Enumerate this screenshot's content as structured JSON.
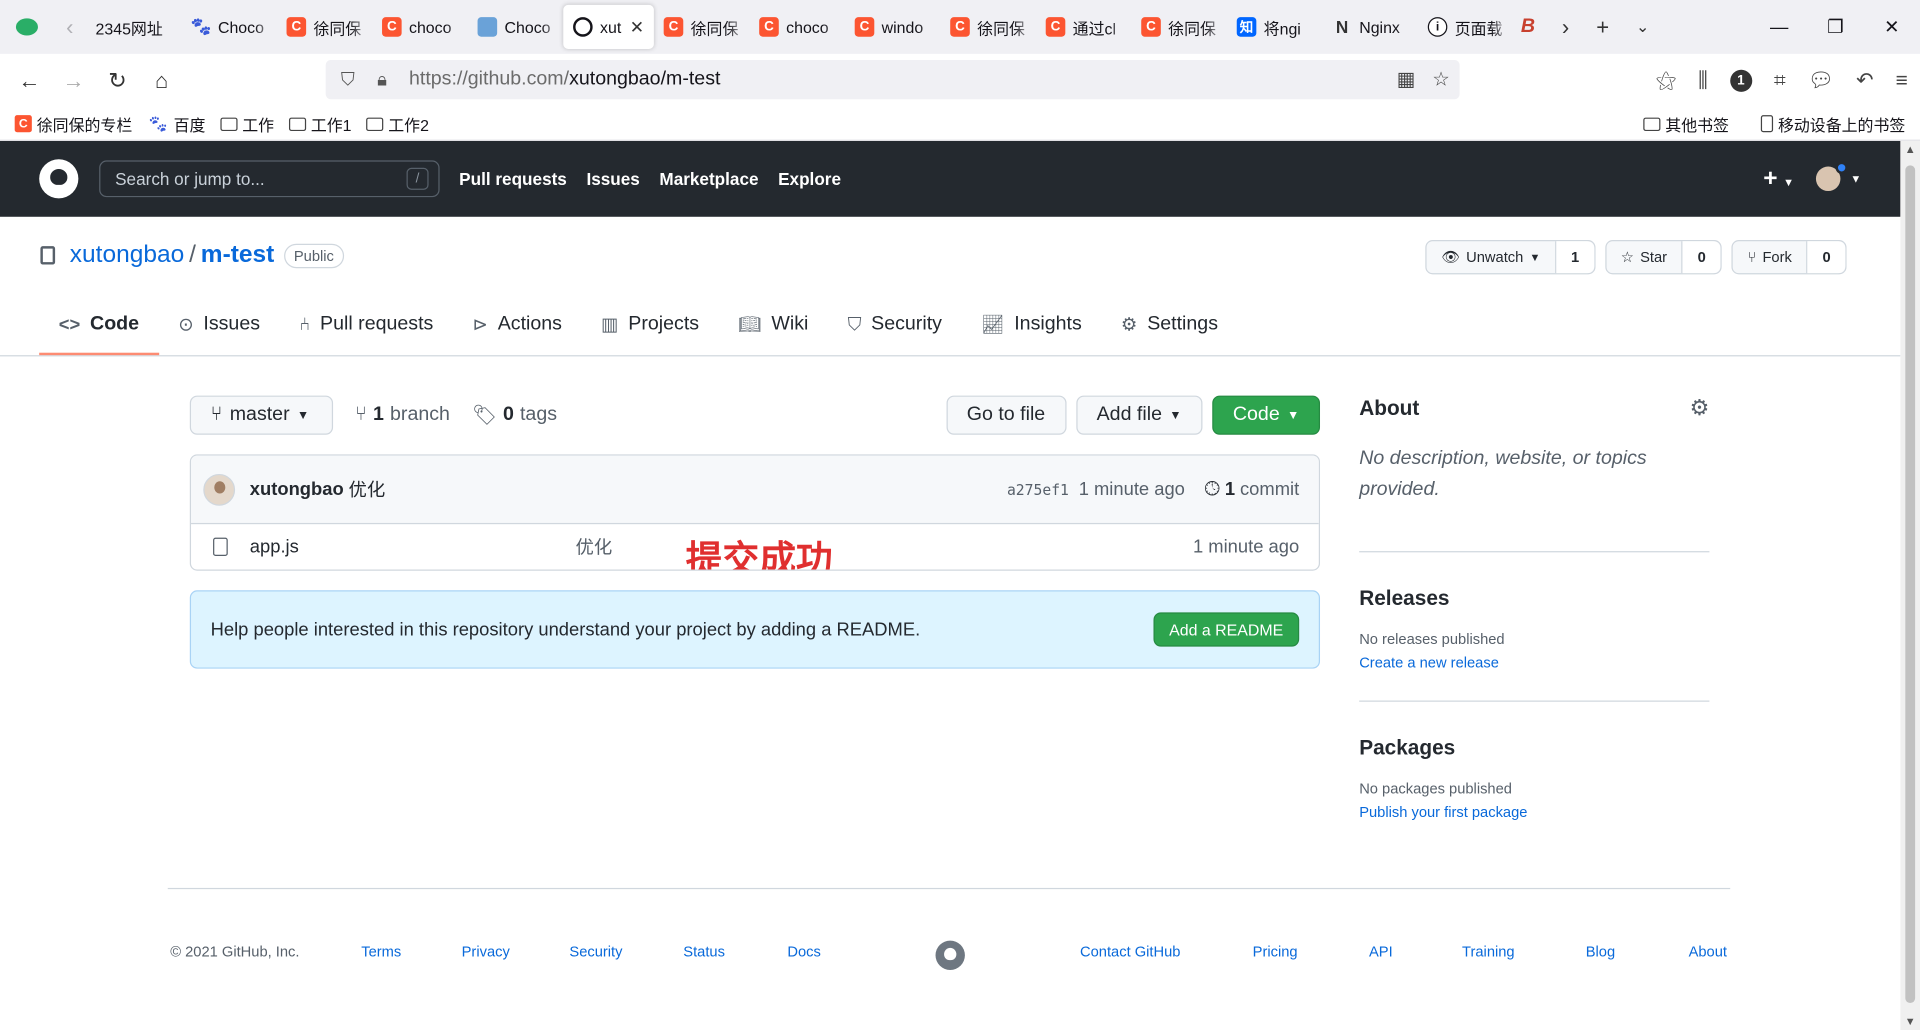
{
  "browser": {
    "tabs": [
      {
        "title": "2345网址",
        "favicon": "2345-icon",
        "active": false
      },
      {
        "title": "Choco",
        "favicon": "paw-icon",
        "active": false
      },
      {
        "title": "徐同保",
        "favicon": "csdn-icon",
        "active": false
      },
      {
        "title": "choco",
        "favicon": "csdn-icon",
        "active": false
      },
      {
        "title": "Choco",
        "favicon": "image-icon",
        "active": false
      },
      {
        "title": "xut",
        "favicon": "github-icon",
        "active": true
      },
      {
        "title": "徐同保",
        "favicon": "csdn-icon",
        "active": false
      },
      {
        "title": "choco",
        "favicon": "csdn-icon",
        "active": false
      },
      {
        "title": "windo",
        "favicon": "csdn-icon",
        "active": false
      },
      {
        "title": "徐同保",
        "favicon": "csdn-icon",
        "active": false
      },
      {
        "title": "通过cl",
        "favicon": "csdn-icon",
        "active": false
      },
      {
        "title": "徐同保",
        "favicon": "csdn-icon",
        "active": false
      },
      {
        "title": "将ngi",
        "favicon": "zhihu-icon",
        "active": false
      },
      {
        "title": "Nginx",
        "favicon": "nginx-icon",
        "active": false
      },
      {
        "title": "页面载",
        "favicon": "info-icon",
        "active": false
      }
    ],
    "url_host": "https://github.com/",
    "url_path": "xutongbao/m-test",
    "bookmarks_left": [
      "徐同保的专栏",
      "百度",
      "工作",
      "工作1",
      "工作2"
    ],
    "bookmarks_right": [
      "其他书签",
      "移动设备上的书签"
    ]
  },
  "github": {
    "search_placeholder": "Search or jump to...",
    "search_key": "/",
    "nav": [
      "Pull requests",
      "Issues",
      "Marketplace",
      "Explore"
    ]
  },
  "repo": {
    "owner": "xutongbao",
    "separator": "/",
    "name": "m-test",
    "visibility": "Public",
    "watch_label": "Unwatch",
    "watch_count": "1",
    "star_label": "Star",
    "star_count": "0",
    "fork_label": "Fork",
    "fork_count": "0",
    "tabs": [
      "Code",
      "Issues",
      "Pull requests",
      "Actions",
      "Projects",
      "Wiki",
      "Security",
      "Insights",
      "Settings"
    ]
  },
  "code": {
    "branch": "master",
    "branch_count": "1",
    "branch_word": "branch",
    "tag_count": "0",
    "tag_word": "tags",
    "goto_file": "Go to file",
    "add_file": "Add file",
    "code_button": "Code",
    "commit_author": "xutongbao",
    "commit_message": "优化",
    "commit_sha": "a275ef1",
    "commit_age": "1 minute ago",
    "commit_count": "1",
    "commit_word": "commit",
    "files": [
      {
        "name": "app.js",
        "message": "优化",
        "age": "1 minute ago"
      }
    ],
    "annotation": "提交成功",
    "readme_prompt": "Help people interested in this repository understand your project by adding a README.",
    "readme_button": "Add a README"
  },
  "sidebar": {
    "about_title": "About",
    "about_text": "No description, website, or topics provided.",
    "releases_title": "Releases",
    "releases_text": "No releases published",
    "releases_link": "Create a new release",
    "packages_title": "Packages",
    "packages_text": "No packages published",
    "packages_link": "Publish your first package"
  },
  "footer": {
    "copyright": "© 2021 GitHub, Inc.",
    "links_left": [
      "Terms",
      "Privacy",
      "Security",
      "Status",
      "Docs"
    ],
    "links_right": [
      "Contact GitHub",
      "Pricing",
      "API",
      "Training",
      "Blog",
      "About"
    ]
  },
  "colors": {
    "header_bg": "#24292f",
    "link": "#0969da",
    "green_button": "#2da44e",
    "annotation": "#e02f2f",
    "active_tab_underline": "#fd8c73"
  }
}
